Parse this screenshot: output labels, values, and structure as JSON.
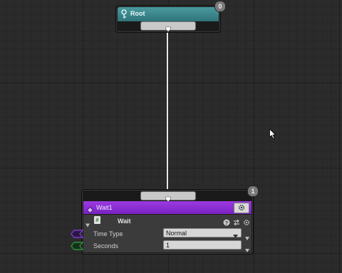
{
  "canvas": {
    "background": "#2b2b2b",
    "grid_color": "#262626"
  },
  "root_node": {
    "title": "Root",
    "icon": "root-icon",
    "title_color": "#3f8c91",
    "badge": "0"
  },
  "wait_node": {
    "title": "Wait1",
    "icon": "diamond-icon",
    "title_color": "#8a2fd6",
    "badge": "1",
    "task": {
      "name": "Wait",
      "type_icon": "hash-icon",
      "header_icons": [
        "help-icon",
        "swap-icon",
        "gear-icon"
      ],
      "properties": [
        {
          "label": "Time Type",
          "value": "Normal",
          "kind": "dropdown",
          "port_color": "#7a3ccf"
        },
        {
          "label": "Seconds",
          "value": "1",
          "kind": "number",
          "port_color": "#2f8f3a"
        }
      ]
    }
  }
}
